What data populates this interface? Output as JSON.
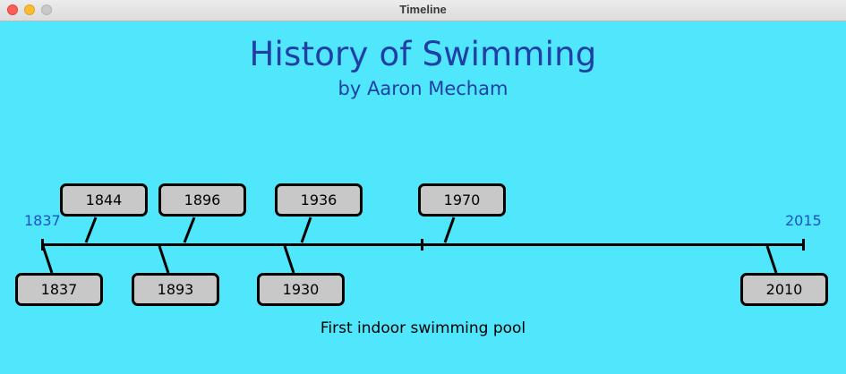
{
  "window": {
    "title": "Timeline"
  },
  "timeline": {
    "title": "History of Swimming",
    "subtitle": "by Aaron Mecham",
    "start_label": "1837",
    "end_label": "2015",
    "events_above": [
      {
        "year": "1844"
      },
      {
        "year": "1896"
      },
      {
        "year": "1936"
      },
      {
        "year": "1970"
      }
    ],
    "events_below": [
      {
        "year": "1837"
      },
      {
        "year": "1893"
      },
      {
        "year": "1930"
      },
      {
        "year": "2010"
      }
    ],
    "caption": "First indoor swimming pool"
  }
}
